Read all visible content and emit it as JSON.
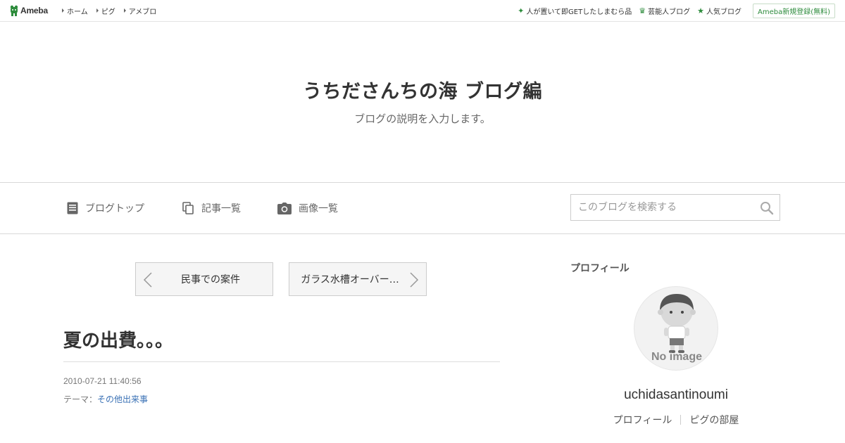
{
  "topbar": {
    "logo_text": "Ameba",
    "nav": [
      {
        "label": "ホーム"
      },
      {
        "label": "ピグ"
      },
      {
        "label": "アメブロ"
      }
    ],
    "right_links": [
      {
        "label": "人が置いて即GETしたしまむら品",
        "icon": "sparkle-icon"
      },
      {
        "label": "芸能人ブログ",
        "icon": "crown-icon"
      },
      {
        "label": "人気ブログ",
        "icon": "star-icon"
      }
    ],
    "signup_label": "Ameba新規登録(無料)"
  },
  "header": {
    "title": "うちださんちの海 ブログ編",
    "description": "ブログの説明を入力します。"
  },
  "global_nav": {
    "items": [
      {
        "label": "ブログトップ",
        "icon": "document-icon"
      },
      {
        "label": "記事一覧",
        "icon": "copy-icon"
      },
      {
        "label": "画像一覧",
        "icon": "camera-icon"
      }
    ],
    "search_placeholder": "このブログを検索する"
  },
  "pager": {
    "prev_label": "民事での案件",
    "next_label": "ガラス水槽オーバー…"
  },
  "entry": {
    "title": "夏の出費。。。",
    "datetime": "2010-07-21 11:40:56",
    "theme_prefix": "テーマ：",
    "theme": "その他出来事"
  },
  "sidebar": {
    "profile_heading": "プロフィール",
    "avatar_caption": "No image",
    "username": "uchidasantinoumi",
    "links": [
      {
        "label": "プロフィール"
      },
      {
        "label": "ピグの部屋"
      }
    ]
  },
  "colors": {
    "accent_green": "#2d8c3c",
    "link_blue": "#3a71b5"
  }
}
